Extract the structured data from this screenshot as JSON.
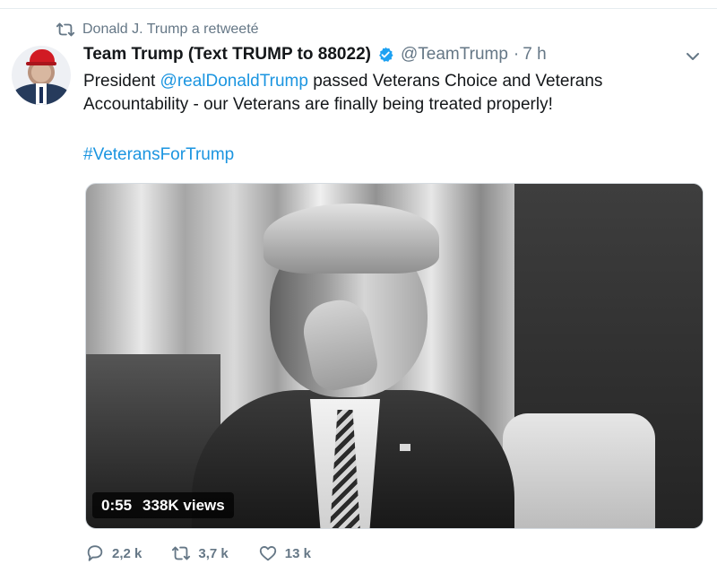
{
  "retweet": {
    "text": "Donald J. Trump a retweeté",
    "icon": "retweet-icon"
  },
  "author": {
    "display_name": "Team Trump (Text TRUMP to 88022)",
    "verified_icon": "verified-badge-icon",
    "handle": "@TeamTrump",
    "separator": "·",
    "time": "7 h",
    "avatar": "profile-avatar"
  },
  "tweet": {
    "prefix": "President ",
    "mention": "@realDonaldTrump",
    "text_line_1_rest": " passed Veterans Choice and Veterans",
    "text_line_2": "Accountability - our Veterans are finally being treated properly!",
    "hashtag": "#VeteransForTrump"
  },
  "video": {
    "duration": "0:55",
    "views": "338K views"
  },
  "actions": {
    "replies": "2,2 k",
    "retweets": "3,7 k",
    "likes": "13 k"
  },
  "colors": {
    "text": "#14171a",
    "secondary": "#657786",
    "link": "#1b95e0",
    "verified": "#1da1f2"
  }
}
